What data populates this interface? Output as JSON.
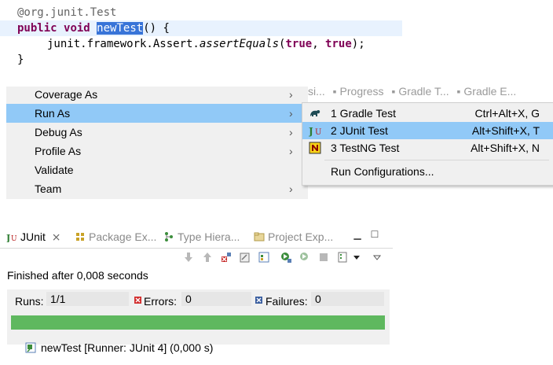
{
  "code": {
    "line1_annotation": "@org.junit.",
    "line1_type": "Test",
    "line2_kw1": "public",
    "line2_kw2": "void",
    "line2_method": "newTest",
    "line2_rest": "() {",
    "line3_prefix": "junit.framework.Assert.",
    "line3_method": "assertEquals",
    "line3_open": "(",
    "line3_arg1": "true",
    "line3_sep": ", ",
    "line3_arg2": "true",
    "line3_close": ");",
    "line4": "}"
  },
  "context_menu": {
    "items": [
      {
        "label": "Coverage As"
      },
      {
        "label": "Run As"
      },
      {
        "label": "Debug As"
      },
      {
        "label": "Profile As"
      },
      {
        "label": "Validate"
      },
      {
        "label": "Team"
      }
    ],
    "active_item": "Run As"
  },
  "submenu": {
    "items": [
      {
        "label": "1 Gradle Test",
        "shortcut": "Ctrl+Alt+X, G",
        "icon": "gradle-icon"
      },
      {
        "label": "2 JUnit Test",
        "shortcut": "Alt+Shift+X, T",
        "icon": "junit-icon"
      },
      {
        "label": "3 TestNG Test",
        "shortcut": "Alt+Shift+X, N",
        "icon": "testng-icon"
      },
      {
        "label": "Run Configurations..."
      }
    ],
    "active_item": "2 JUnit Test"
  },
  "background_tabs": [
    "si...",
    "Progress",
    "Gradle T...",
    "Gradle E..."
  ],
  "junit_view": {
    "tabs": [
      {
        "label": "JUnit",
        "close": "⨯",
        "icon": "junit-icon"
      },
      {
        "label": "Package Ex...",
        "icon": "package-icon"
      },
      {
        "label": "Type Hiera...",
        "icon": "hierarchy-icon"
      },
      {
        "label": "Project Exp...",
        "icon": "project-icon"
      }
    ],
    "status": "Finished after 0,008 seconds",
    "runs_label": "Runs:",
    "runs_value": "1/1",
    "errors_label": "Errors:",
    "errors_value": "0",
    "failures_label": "Failures:",
    "failures_value": "0",
    "progress": 1.0,
    "progress_color": "#5fb85f",
    "result": "newTest [Runner: JUnit 4] (0,000 s)"
  },
  "colors": {
    "selection": "#3874d8",
    "menu_highlight": "#91c9f7",
    "keyword": "#7f0055"
  }
}
